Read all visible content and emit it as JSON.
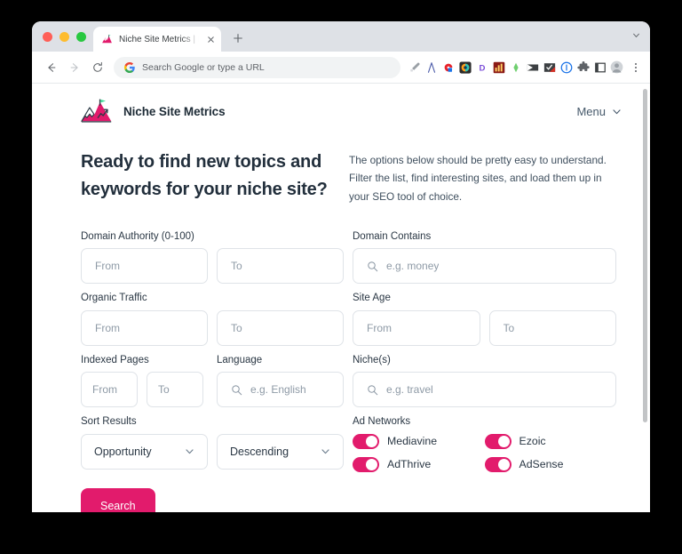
{
  "browser": {
    "tab": {
      "title": "Niche Site Metrics | Find Profitable",
      "favicon_icon": "mountain-logo-icon",
      "close_icon": "close-icon"
    },
    "new_tab_label": "+",
    "window_chevron_icon": "chevron-down-icon",
    "nav": {
      "back_icon": "back-arrow-icon",
      "forward_icon": "forward-arrow-icon",
      "reload_icon": "reload-icon"
    },
    "omnibox": {
      "placeholder": "Search Google or type a URL",
      "value": "Search Google or type a URL",
      "leading_icon": "google-g-icon"
    },
    "extensions": [
      {
        "name": "eyedropper-icon",
        "color": "#8a8f98"
      },
      {
        "name": "compass-pen-icon",
        "color": "#5b6bb0"
      },
      {
        "name": "magnet-red-icon",
        "color": "#e8222a"
      },
      {
        "name": "colorwheel-icon",
        "color": "#2fb2a8"
      },
      {
        "name": "letter-d-icon",
        "color": "#7b4dd8"
      },
      {
        "name": "analytics-chart-icon",
        "color": "#c5342e"
      },
      {
        "name": "green-leaf-icon",
        "color": "#6fcf6f"
      },
      {
        "name": "flag-dark-icon",
        "color": "#3c4043"
      },
      {
        "name": "checkbox-red-icon",
        "color": "#d93025"
      },
      {
        "name": "circle-one-icon",
        "color": "#1a73e8"
      },
      {
        "name": "puzzle-piece-icon",
        "color": "#5f6368"
      },
      {
        "name": "square-outline-icon",
        "color": "#3c4043"
      },
      {
        "name": "avatar-icon",
        "color": "#9aa0a6"
      }
    ],
    "menu_icon": "kebab-menu-icon"
  },
  "site": {
    "brand": "Niche Site Metrics",
    "logo_icon": "mountain-flag-logo-icon",
    "menu_label": "Menu",
    "menu_chevron_icon": "chevron-down-icon"
  },
  "hero": {
    "title": "Ready to find new topics and keywords for your niche site?",
    "subtitle": "The options below should be pretty easy to understand. Filter the list, find interesting sites, and load them up in your SEO tool of choice."
  },
  "form": {
    "domain_authority": {
      "label": "Domain Authority (0-100)",
      "from_placeholder": "From",
      "to_placeholder": "To",
      "from_value": "",
      "to_value": ""
    },
    "domain_contains": {
      "label": "Domain Contains",
      "placeholder": "e.g. money",
      "value": "",
      "icon": "search-icon"
    },
    "organic_traffic": {
      "label": "Organic Traffic",
      "from_placeholder": "From",
      "to_placeholder": "To",
      "from_value": "",
      "to_value": ""
    },
    "site_age": {
      "label": "Site Age",
      "from_placeholder": "From",
      "to_placeholder": "To",
      "from_value": "",
      "to_value": ""
    },
    "indexed_pages": {
      "label": "Indexed Pages",
      "from_placeholder": "From",
      "to_placeholder": "To",
      "from_value": "",
      "to_value": ""
    },
    "language": {
      "label": "Language",
      "placeholder": "e.g. English",
      "value": "",
      "icon": "search-icon"
    },
    "niches": {
      "label": "Niche(s)",
      "placeholder": "e.g. travel",
      "value": "",
      "icon": "search-icon"
    },
    "sort_results": {
      "label": "Sort Results",
      "field_value": "Opportunity",
      "direction_value": "Descending",
      "chevron_icon": "chevron-down-icon"
    },
    "ad_networks": {
      "label": "Ad Networks",
      "items": [
        {
          "label": "Mediavine",
          "enabled": true
        },
        {
          "label": "Ezoic",
          "enabled": true
        },
        {
          "label": "AdThrive",
          "enabled": true
        },
        {
          "label": "AdSense",
          "enabled": true
        }
      ]
    },
    "search_button": "Search"
  },
  "colors": {
    "accent_pink": "#e21b6c",
    "text_dark": "#222f3c",
    "text_muted": "#8e9aa6",
    "border": "#dfe3e8"
  }
}
